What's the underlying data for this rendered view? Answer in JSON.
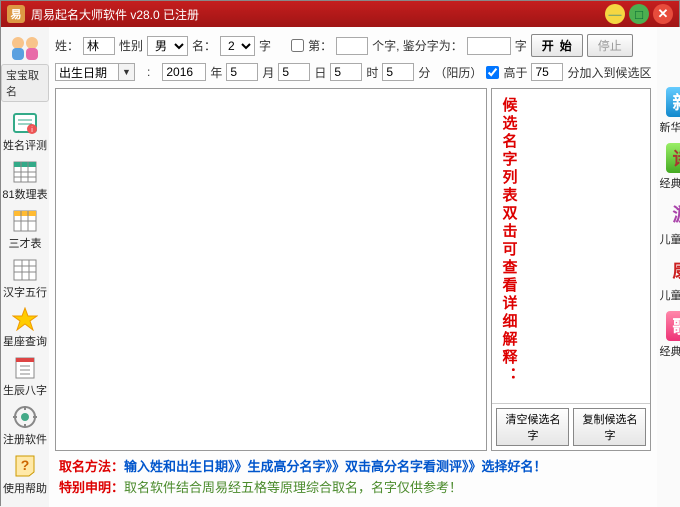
{
  "window": {
    "logo_char": "易",
    "title": "周易起名大师软件 v28.0 已注册"
  },
  "left_tools": {
    "tab": "宝宝取名",
    "items": [
      {
        "label": "姓名评测"
      },
      {
        "label": "81数理表"
      },
      {
        "label": "三才表"
      },
      {
        "label": "汉字五行"
      },
      {
        "label": "星座查询"
      },
      {
        "label": "生辰八字"
      },
      {
        "label": "注册软件"
      },
      {
        "label": "使用帮助"
      }
    ]
  },
  "form": {
    "surname_label": "姓：",
    "surname_value": "林",
    "gender_label": "性别",
    "gender_value": "男",
    "name_label": "名：",
    "name_count": "2",
    "name_suffix": "字",
    "di_label": "第：",
    "di_suffix": "个字, 鉴分字为：",
    "di_suffix2": "字",
    "start_btn": "开始",
    "stop_btn": "停止",
    "birthdate_label": "出生日期",
    "year": "2016",
    "year_suf": "年",
    "month": "5",
    "month_suf": "月",
    "day": "5",
    "day_suf": "日",
    "hour": "5",
    "hour_suf": "时",
    "min": "5",
    "min_suf": "分",
    "calendar": "（阳历）",
    "score_chk": "高于",
    "score_val": "75",
    "score_suf": "分加入到候选区"
  },
  "candidate": {
    "hint": "候选名字列表双击可查看详细解释：",
    "clear_btn": "清空候选名字",
    "copy_btn": "复制候选名字"
  },
  "right_tools": [
    {
      "icon": "新",
      "label": "新华字典",
      "cls": "ric-blue"
    },
    {
      "icon": "诗",
      "label": "经典诗词",
      "cls": "ric-green"
    },
    {
      "icon": "游",
      "label": "儿童游戏",
      "cls": "ric-purple"
    },
    {
      "icon": "康",
      "label": "儿童健康",
      "cls": "ric-red"
    },
    {
      "icon": "歌",
      "label": "经典儿歌",
      "cls": "ric-pink"
    }
  ],
  "footer": {
    "method_key": "取名方法：",
    "method_val": "输入姓和出生日期》》生成高分名字》》双击高分名字看测评》》选择好名！",
    "declare_key": "特别申明：",
    "declare_val": "取名软件结合周易经五格等原理综合取名，名字仅供参考！"
  }
}
